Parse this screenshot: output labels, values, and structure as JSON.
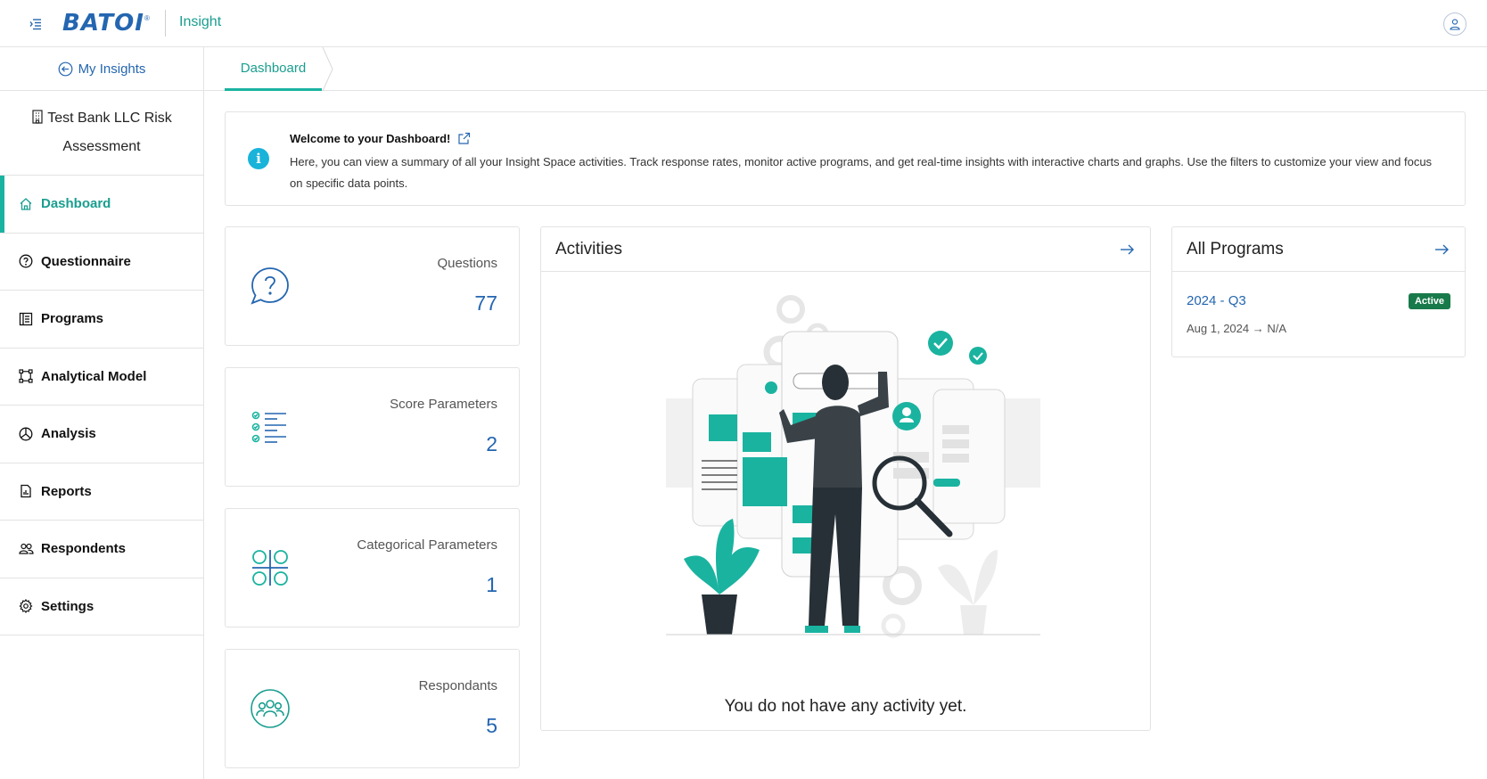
{
  "topbar": {
    "logo": "BATOI",
    "logo_mark": "®",
    "app_name": "Insight"
  },
  "sidebar": {
    "back_label": "My Insights",
    "project_title": "Test Bank LLC Risk Assessment",
    "items": [
      {
        "label": "Dashboard",
        "icon": "home-icon",
        "active": true
      },
      {
        "label": "Questionnaire",
        "icon": "question-circle-icon"
      },
      {
        "label": "Programs",
        "icon": "list-document-icon"
      },
      {
        "label": "Analytical Model",
        "icon": "nodes-icon"
      },
      {
        "label": "Analysis",
        "icon": "pie-chart-icon"
      },
      {
        "label": "Reports",
        "icon": "report-icon"
      },
      {
        "label": "Respondents",
        "icon": "users-icon"
      },
      {
        "label": "Settings",
        "icon": "gear-icon"
      }
    ]
  },
  "tabs": [
    {
      "label": "Dashboard"
    }
  ],
  "info": {
    "title": "Welcome to your Dashboard!",
    "text": "Here, you can view a summary of all your Insight Space activities. Track response rates, monitor active programs, and get real-time insights with interactive charts and graphs. Use the filters to customize your view and focus on specific data points."
  },
  "stats": [
    {
      "label": "Questions",
      "value": "77",
      "icon": "question-bubble-icon"
    },
    {
      "label": "Score Parameters",
      "value": "2",
      "icon": "checklist-icon"
    },
    {
      "label": "Categorical Parameters",
      "value": "1",
      "icon": "command-icon"
    },
    {
      "label": "Respondants",
      "value": "5",
      "icon": "group-icon"
    }
  ],
  "activities": {
    "title": "Activities",
    "empty_message": "You do not have any activity yet."
  },
  "programs": {
    "title": "All Programs",
    "items": [
      {
        "name": "2024 - Q3",
        "status": "Active",
        "dates": "Aug 1, 2024 → N/A"
      }
    ]
  },
  "colors": {
    "brand_blue": "#2466b0",
    "accent_teal": "#1ab3a0",
    "active_badge": "#187a4a"
  }
}
